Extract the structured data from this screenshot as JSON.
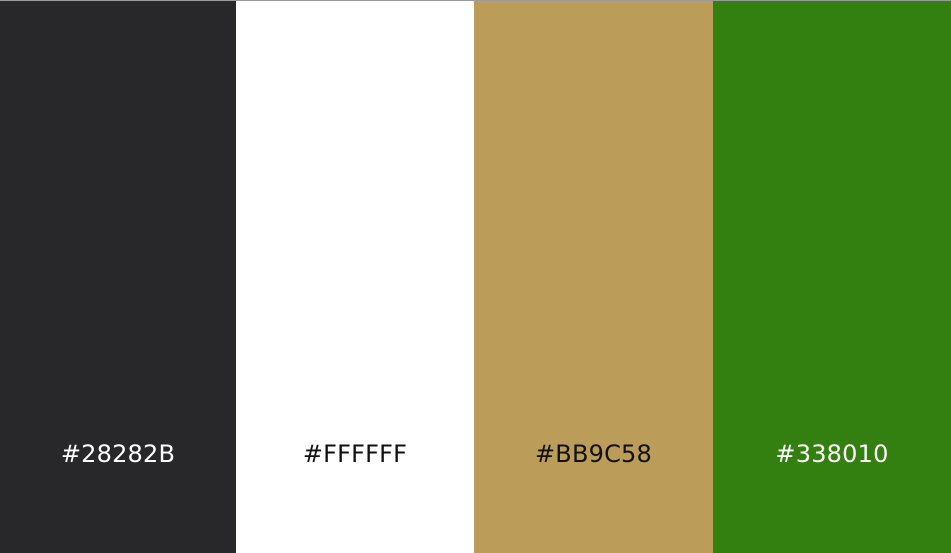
{
  "palette": {
    "swatches": [
      {
        "hex": "#28282B",
        "label": "#28282B",
        "text_color": "#FFFFFF"
      },
      {
        "hex": "#FFFFFF",
        "label": "#FFFFFF",
        "text_color": "#111111"
      },
      {
        "hex": "#BB9C58",
        "label": "#BB9C58",
        "text_color": "#111111"
      },
      {
        "hex": "#338010",
        "label": "#338010",
        "text_color": "#FFFFFF"
      }
    ]
  }
}
